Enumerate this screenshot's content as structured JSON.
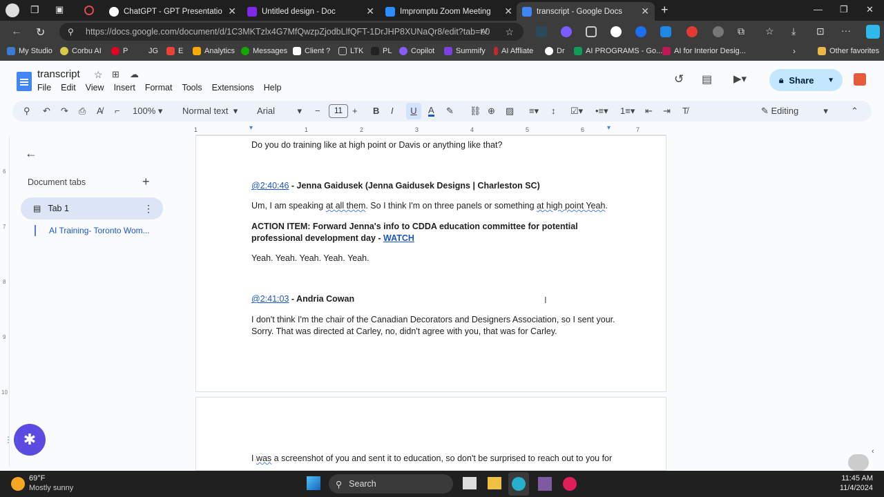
{
  "browser": {
    "tabs": [
      {
        "title": "ChatGPT - GPT Presentation Build",
        "color": "#ffffff"
      },
      {
        "title": "Untitled design - Doc",
        "color": "#7d2ae8"
      },
      {
        "title": "Impromptu Zoom Meeting",
        "color": "#2d8cff"
      },
      {
        "title": "transcript - Google Docs",
        "color": "#4285f4",
        "active": true
      }
    ],
    "url": "https://docs.google.com/document/d/1C3MKTzlx4G7MfQwzpZjodbLlfQFT-1DrJHP8XUNaQr8/edit?tab=t.0",
    "bookmarks": [
      "My Studio",
      "Corbu AI",
      "P",
      "JG",
      "E",
      "Analytics",
      "Messages",
      "Client ?",
      "LTK",
      "PL",
      "Copilot",
      "Summify",
      "AI Affliate",
      "Dr",
      "AI PROGRAMS - Go...",
      "AI for Interior Desig..."
    ],
    "other_favorites": "Other favorites"
  },
  "docs": {
    "title": "transcript",
    "menu": [
      "File",
      "Edit",
      "View",
      "Insert",
      "Format",
      "Tools",
      "Extensions",
      "Help"
    ],
    "share_label": "Share",
    "toolbar": {
      "zoom": "100%",
      "style": "Normal text",
      "font": "Arial",
      "size": "11",
      "mode": "Editing"
    },
    "ruler_marks": [
      "1",
      "1",
      "2",
      "3",
      "4",
      "5",
      "6",
      "7"
    ],
    "vruler_marks": [
      "6",
      "7",
      "8",
      "9",
      "10"
    ],
    "side": {
      "heading": "Document tabs",
      "tab": "Tab 1",
      "subtab": "AI Training- Toronto Wom..."
    }
  },
  "content": {
    "line1": "Do you do training like at high point or Davis or anything like that?",
    "ts1": "@2:40:46",
    "sp1": " - Jenna Gaidusek (Jenna Gaidusek Designs | Charleston SC)",
    "p2_a": "Um, I am speaking ",
    "p2_b": "at all them",
    "p2_c": ". So I think I'm on three panels or something ",
    "p2_d": "at high point Yeah",
    "p2_e": ".",
    "action1": "ACTION ITEM: Forward Jenna's info to CDDA education committee for potential",
    "action2": "professional development day - ",
    "watch": "WATCH",
    "yeah": "Yeah. Yeah. Yeah. Yeah. Yeah.",
    "ts2": "@2:41:03",
    "sp2": " - Andria Cowan",
    "p3a": "I don't think I'm the chair of the Canadian Decorators and Designers Association, so I sent your.",
    "p3b": "Sorry. That was directed at Carley, no, didn't agree with you, that was for Carley.",
    "p4_a": "I ",
    "p4_b": "was",
    "p4_c": " a screenshot of you and sent it to education, so don't be surprised to reach out to you for"
  },
  "taskbar": {
    "temp": "69°F",
    "weather": "Mostly sunny",
    "search": "Search",
    "time": "11:45 AM",
    "date": "11/4/2024"
  }
}
